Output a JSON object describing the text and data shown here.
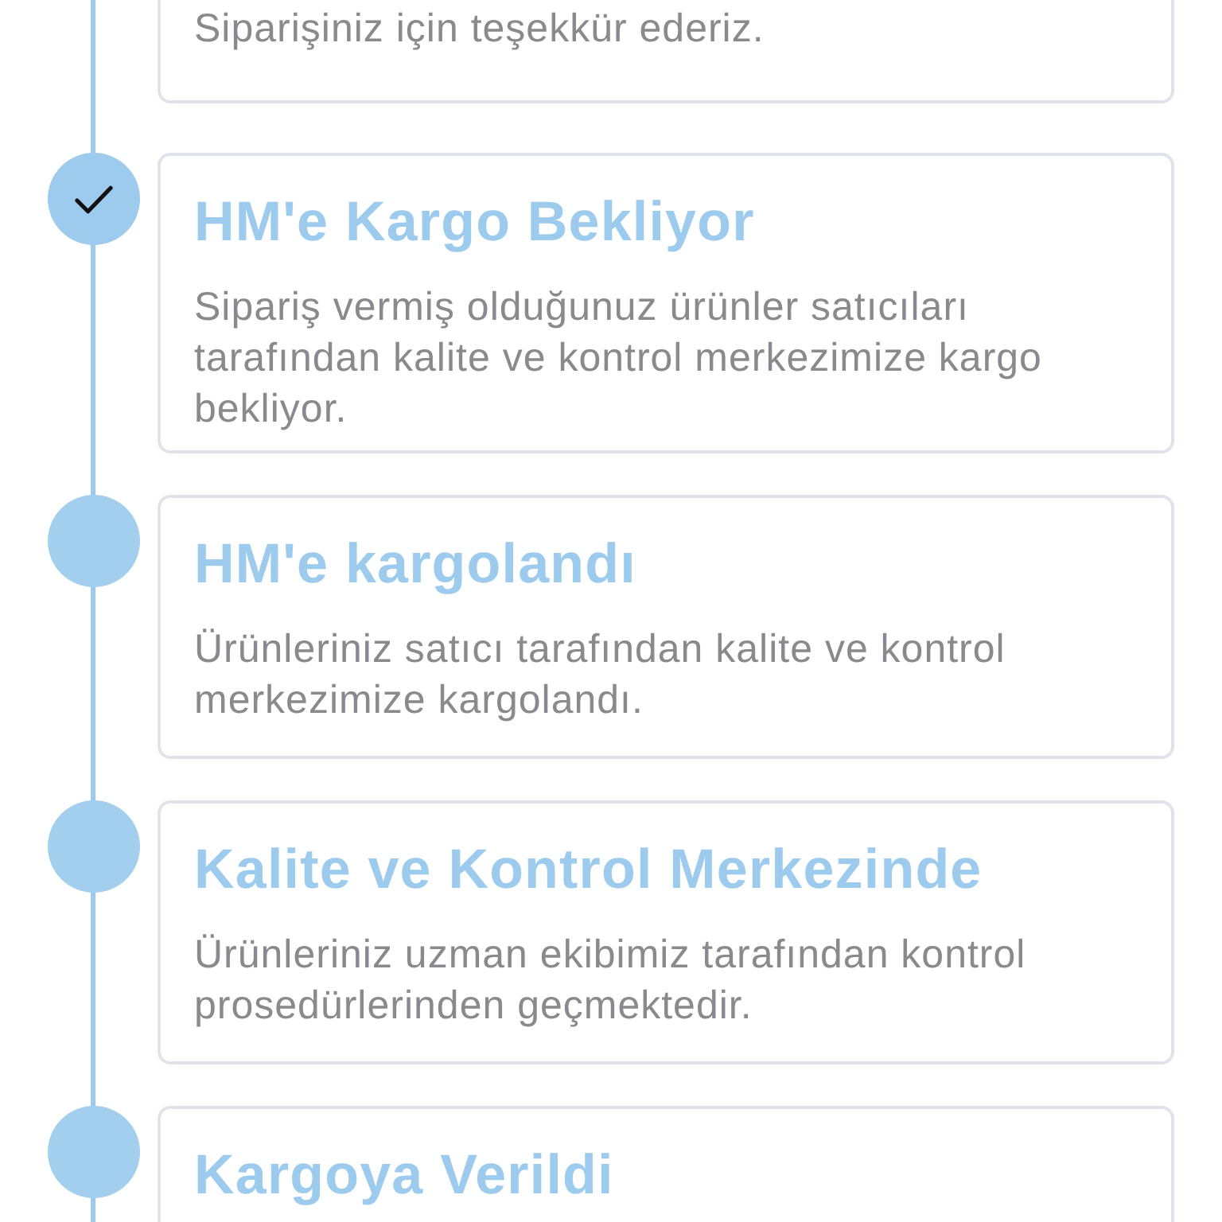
{
  "previous_step": {
    "description": "Siparişiniz için teşekkür ederiz."
  },
  "steps": [
    {
      "title": "HM'e Kargo Bekliyor",
      "description": "Sipariş vermiş olduğunuz ürünler satıcıları tarafından kalite ve kontrol merkezimize kargo bekliyor.",
      "completed": true
    },
    {
      "title": "HM'e kargolandı",
      "description": "Ürünleriniz satıcı tarafından kalite ve kontrol merkezimize kargolandı.",
      "completed": false
    },
    {
      "title": "Kalite ve Kontrol Merkezinde",
      "description": "Ürünleriniz uzman ekibimiz tarafından kontrol prosedürlerinden geçmektedir.",
      "completed": false
    },
    {
      "title": "Kargoya Verildi",
      "completed": false
    }
  ]
}
